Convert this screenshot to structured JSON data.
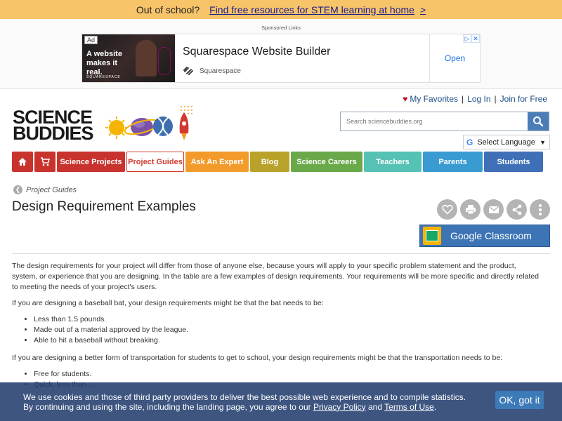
{
  "promo": {
    "lead": "Out of school?",
    "link": "Find free resources for STEM learning at home",
    "arrow": ">"
  },
  "ad": {
    "sponsored": "Sponsored Links",
    "tag": "Ad",
    "image_text": "A website makes it real.",
    "image_logo": "SQUARESPACE",
    "title": "Squarespace Website Builder",
    "brand": "Squarespace",
    "open": "Open",
    "close_info": "▷",
    "close_x": "✕"
  },
  "account": {
    "favorites": "My Favorites",
    "login": "Log In",
    "join": "Join for Free",
    "sep": "|"
  },
  "logo": {
    "line1": "SCIENCE",
    "line2": "BUDDIES"
  },
  "search": {
    "placeholder": "Search sciencebuddies.org"
  },
  "language": {
    "g": "G",
    "label": "Select Language",
    "caret": "▼"
  },
  "nav": {
    "science_projects": "Science Projects",
    "project_guides": "Project Guides",
    "ask_an_expert": "Ask An Expert",
    "blog": "Blog",
    "science_careers": "Science Careers",
    "teachers": "Teachers",
    "parents": "Parents",
    "students": "Students"
  },
  "breadcrumb": "Project Guides",
  "page_title": "Design Requirement Examples",
  "google_classroom": "Google Classroom",
  "content": {
    "p1": "The design requirements for your project will differ from those of anyone else, because yours will apply to your specific problem statement and the product, system, or experience that you are designing. In the table are a few examples of design requirements. Your requirements will be more specific and directly related to meeting the needs of your project's users.",
    "p2": "If you are designing a baseball bat, your design requirements might be that the bat needs to be:",
    "list1": [
      "Less than 1.5 pounds.",
      "Made out of a material approved by the league.",
      "Able to hit a baseball without breaking."
    ],
    "p3": "If you are designing a better form of transportation for students to get to school, your design requirements might be that the transportation needs to be:",
    "list2": [
      "Free for students.",
      "Quick, less than ..."
    ]
  },
  "cookie": {
    "line1": "We use cookies and those of third party providers to deliver the best possible web experience and to compile statistics.",
    "line2_pre": "By continuing and using the site, including the landing page, you agree to our ",
    "privacy": "Privacy Policy",
    "and": " and ",
    "terms": "Terms of Use",
    "dot": ".",
    "ok": "OK, got it"
  }
}
